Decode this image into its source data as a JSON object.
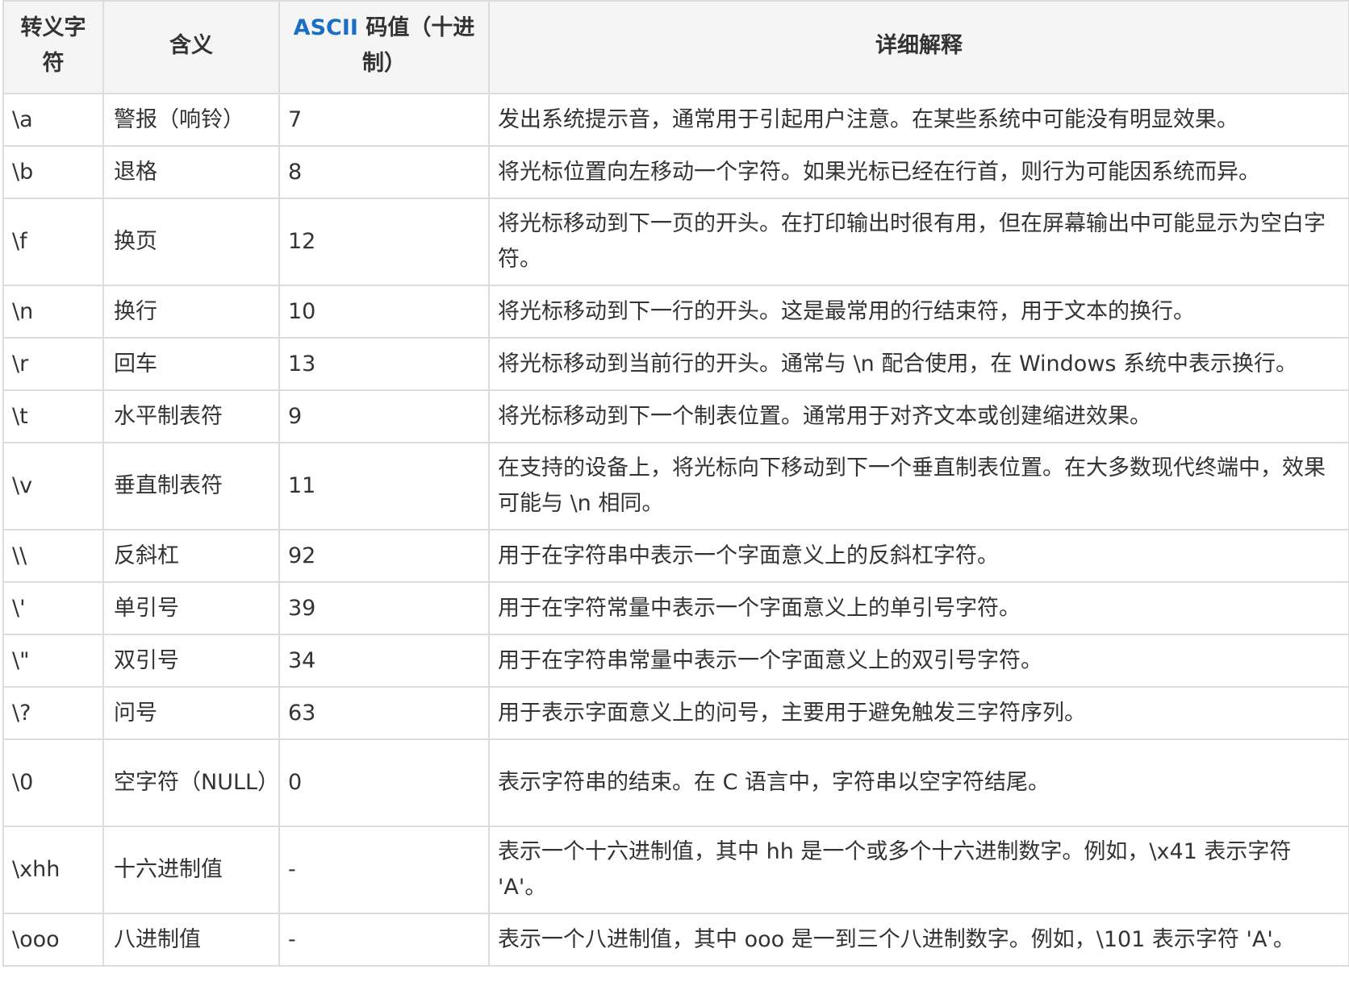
{
  "header": {
    "escape": "转义字符",
    "meaning": "含义",
    "ascii_accent": "ASCII",
    "ascii_rest": " 码值（十进制）",
    "detail": "详细解释"
  },
  "rows": [
    {
      "escape": "\\a",
      "meaning": "警报（响铃）",
      "code": "7",
      "detail": "发出系统提示音，通常用于引起用户注意。在某些系统中可能没有明显效果。"
    },
    {
      "escape": "\\b",
      "meaning": "退格",
      "code": "8",
      "detail": "将光标位置向左移动一个字符。如果光标已经在行首，则行为可能因系统而异。"
    },
    {
      "escape": "\\f",
      "meaning": "换页",
      "code": "12",
      "detail": "将光标移动到下一页的开头。在打印输出时很有用，但在屏幕输出中可能显示为空白字符。"
    },
    {
      "escape": "\\n",
      "meaning": "换行",
      "code": "10",
      "detail": "将光标移动到下一行的开头。这是最常用的行结束符，用于文本的换行。"
    },
    {
      "escape": "\\r",
      "meaning": "回车",
      "code": "13",
      "detail": "将光标移动到当前行的开头。通常与 \\n 配合使用，在 Windows 系统中表示换行。"
    },
    {
      "escape": "\\t",
      "meaning": "水平制表符",
      "code": "9",
      "detail": "将光标移动到下一个制表位置。通常用于对齐文本或创建缩进效果。"
    },
    {
      "escape": "\\v",
      "meaning": "垂直制表符",
      "code": "11",
      "detail": "在支持的设备上，将光标向下移动到下一个垂直制表位置。在大多数现代终端中，效果可能与 \\n 相同。"
    },
    {
      "escape": "\\\\",
      "meaning": "反斜杠",
      "code": "92",
      "detail": "用于在字符串中表示一个字面意义上的反斜杠字符。"
    },
    {
      "escape": "\\'",
      "meaning": "单引号",
      "code": "39",
      "detail": "用于在字符常量中表示一个字面意义上的单引号字符。"
    },
    {
      "escape": "\\\"",
      "meaning": "双引号",
      "code": "34",
      "detail": "用于在字符串常量中表示一个字面意义上的双引号字符。"
    },
    {
      "escape": "\\?",
      "meaning": "问号",
      "code": "63",
      "detail": "用于表示字面意义上的问号，主要用于避免触发三字符序列。"
    },
    {
      "escape": "\\0",
      "meaning": "空字符（NULL）",
      "code": "0",
      "detail": "表示字符串的结束。在 C 语言中，字符串以空字符结尾。"
    },
    {
      "escape": "\\xhh",
      "meaning": "十六进制值",
      "code": "-",
      "detail": "表示一个十六进制值，其中 hh 是一个或多个十六进制数字。例如，\\x41 表示字符 'A'。"
    },
    {
      "escape": "\\ooo",
      "meaning": "八进制值",
      "code": "-",
      "detail": "表示一个八进制值，其中 ooo 是一到三个八进制数字。例如，\\101 表示字符 'A'。"
    }
  ],
  "colors": {
    "accent": "#1a6fc4",
    "border": "#dcdcdc",
    "header_bg": "#f5f5f5"
  }
}
